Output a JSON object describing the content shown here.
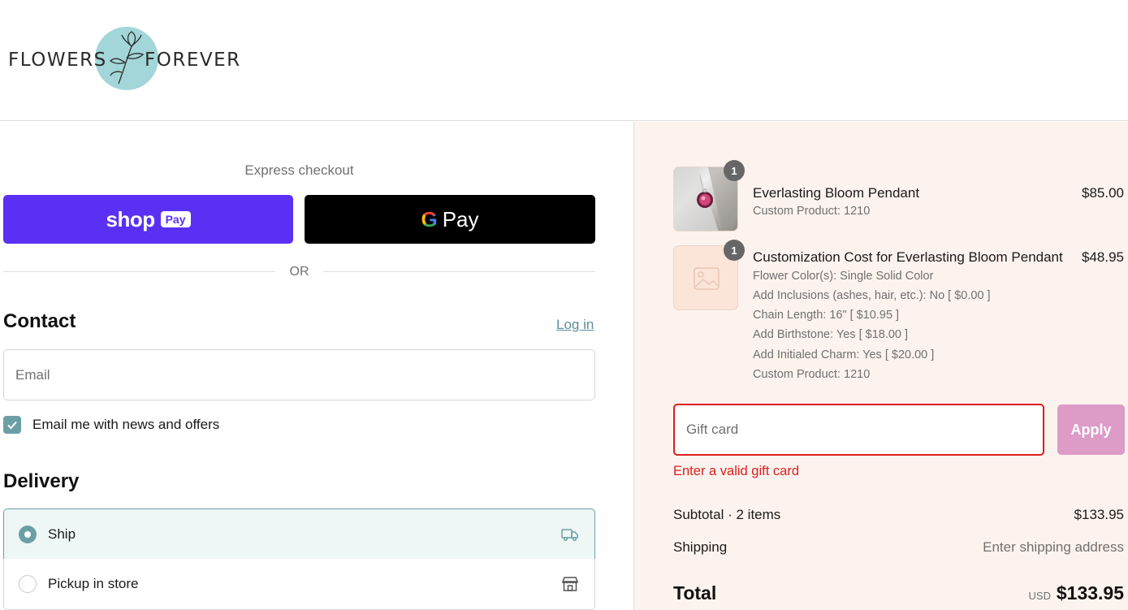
{
  "brand": {
    "name_left": "FLOWERS",
    "name_right": "FOREVER",
    "logo_color": "#a3d6d8"
  },
  "express": {
    "title": "Express checkout",
    "shop_pay": {
      "word": "shop",
      "badge": "Pay",
      "color": "#5a31f4"
    },
    "google_pay": {
      "g": "G",
      "word": "Pay",
      "color": "#000000"
    },
    "divider": "OR"
  },
  "contact": {
    "title": "Contact",
    "login_link": "Log in",
    "email_placeholder": "Email",
    "email_value": "",
    "newsletter_label": "Email me with news and offers",
    "newsletter_checked": true
  },
  "delivery": {
    "title": "Delivery",
    "options": [
      {
        "label": "Ship",
        "selected": true,
        "icon": "truck-icon"
      },
      {
        "label": "Pickup in store",
        "selected": false,
        "icon": "store-icon"
      }
    ]
  },
  "cart": {
    "items": [
      {
        "title": "Everlasting Bloom Pendant",
        "price": "$85.00",
        "quantity": "1",
        "details": [
          "Custom Product: 1210"
        ]
      },
      {
        "title": "Customization Cost for Everlasting Bloom Pendant",
        "price": "$48.95",
        "quantity": "1",
        "details": [
          "Flower Color(s): Single Solid Color",
          "Add Inclusions (ashes, hair, etc.): No [ $0.00 ]",
          "Chain Length: 16\" [ $10.95 ]",
          "Add Birthstone: Yes [ $18.00 ]",
          "Add Initialed Charm: Yes [ $20.00 ]",
          "Custom Product: 1210"
        ]
      }
    ]
  },
  "gift_card": {
    "placeholder": "Gift card",
    "apply_label": "Apply",
    "error": "Enter a valid gift card",
    "error_color": "#dd1d1d"
  },
  "summary": {
    "subtotal_label": "Subtotal · 2 items",
    "subtotal_value": "$133.95",
    "shipping_label": "Shipping",
    "shipping_value": "Enter shipping address",
    "total_label": "Total",
    "currency": "USD",
    "total_value": "$133.95"
  }
}
